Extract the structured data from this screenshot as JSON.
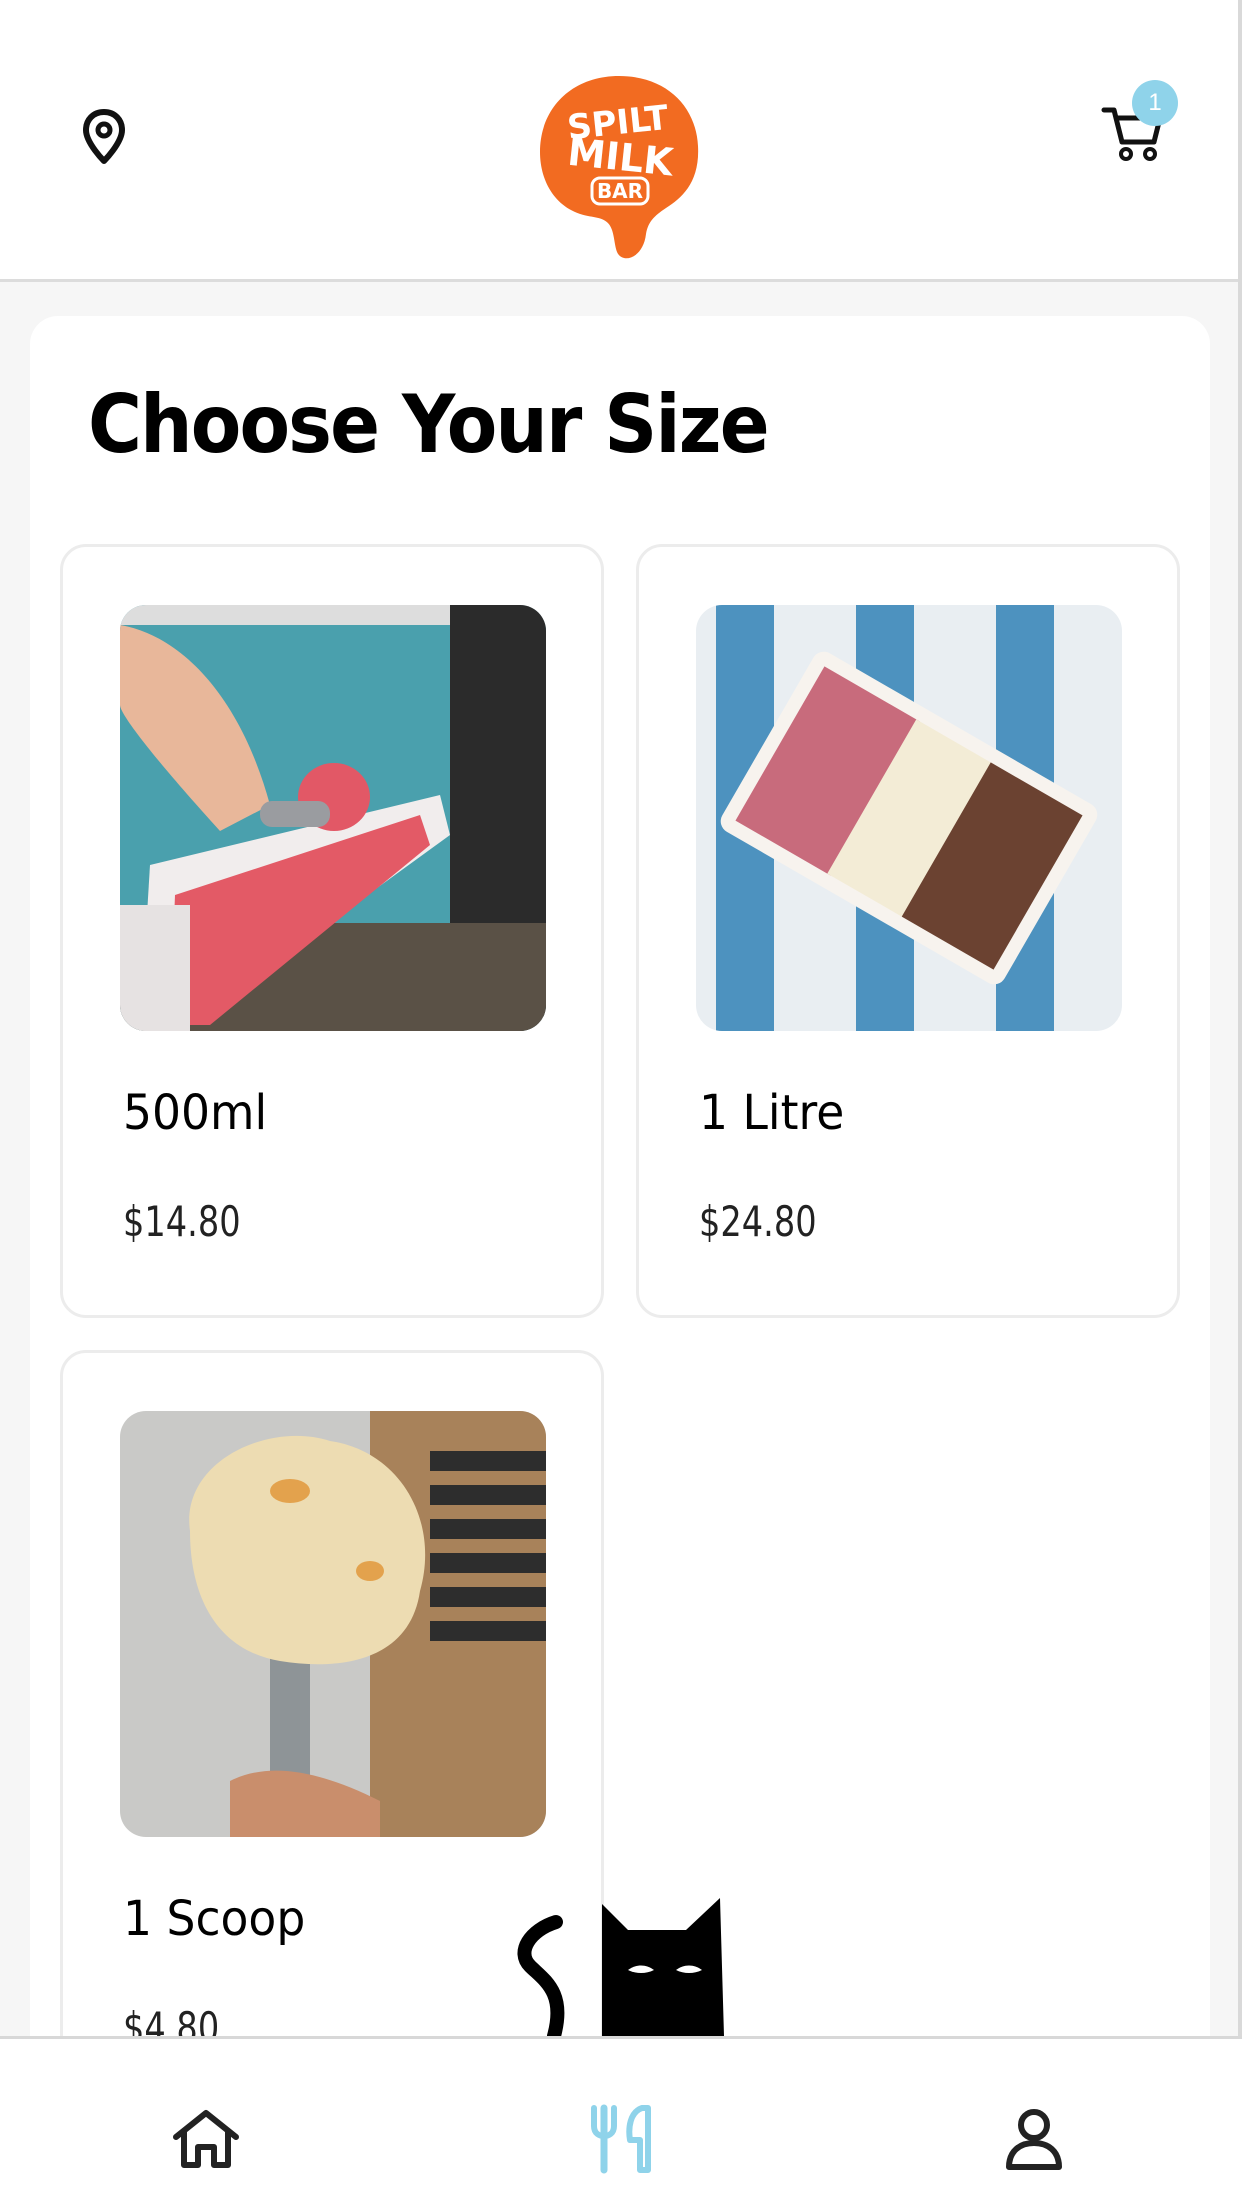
{
  "header": {
    "logo_text": "SPILT MILK BAR",
    "cart_count": "1",
    "icons": [
      "location-pin-icon",
      "cart-icon"
    ]
  },
  "page": {
    "title": "Choose Your Size"
  },
  "sizes": [
    {
      "name": "500ml",
      "price": "$14.80",
      "image": "scooping-pink-gelato-tub"
    },
    {
      "name": "1 Litre",
      "price": "$24.80",
      "image": "three-flavour-tub-top-view"
    },
    {
      "name": "1 Scoop",
      "price": "$4.80",
      "image": "scoop-of-gelato"
    }
  ],
  "bottom_nav": {
    "items": [
      {
        "icon": "home-icon",
        "active": false
      },
      {
        "icon": "utensils-icon",
        "active": true
      },
      {
        "icon": "user-icon",
        "active": false
      }
    ]
  },
  "colors": {
    "brand_orange": "#f26b21",
    "accent_blue": "#8fd3ea",
    "text": "#000000"
  }
}
